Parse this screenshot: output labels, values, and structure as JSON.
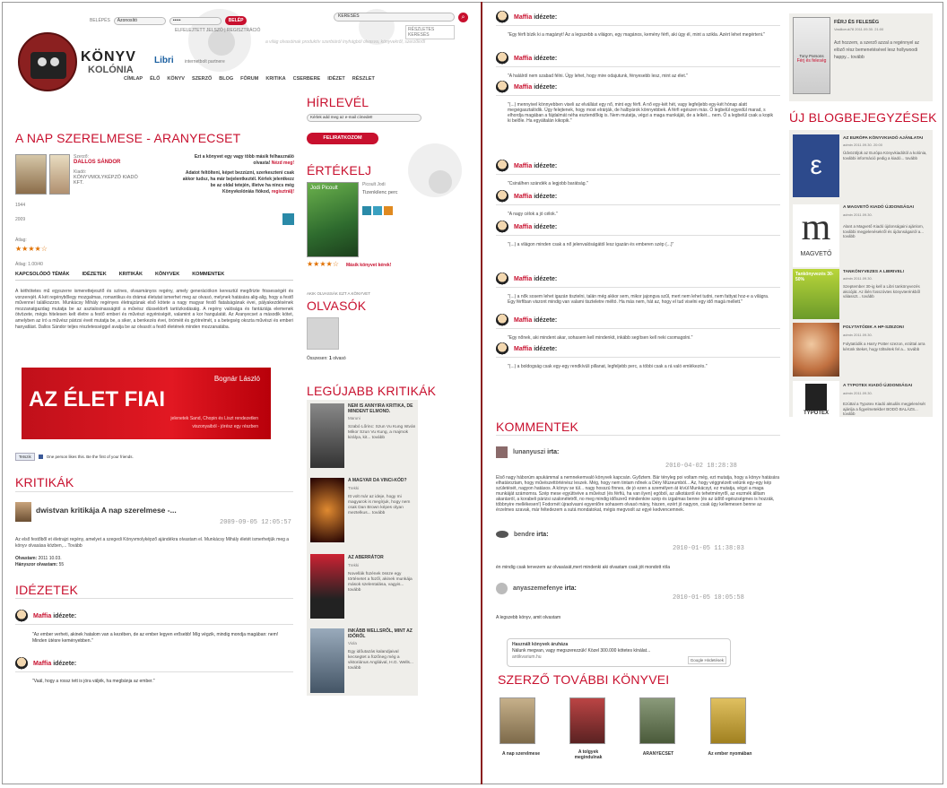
{
  "search": {
    "label": "KERESÉS",
    "advanced": "RÉSZLETES KERESÉS"
  },
  "login": {
    "label": "BELÉPÉS",
    "user": "Azonosító",
    "go": "BELÉP",
    "links": "ELFELEJTETT JELSZÓ | REGISZTRÁCIÓ"
  },
  "logo": {
    "text1": "KÖNYV",
    "text2": "KOLÓNIA",
    "partner": "Libri",
    "partner_sub": "internetbolt partnere"
  },
  "tagline": "a világ olvasóinak produktív szerbiáról ínyhágból olvasva, könyvekről, szerzőkről",
  "nav": [
    "CÍMLAP",
    "ÉLŐ",
    "KÖNYV",
    "SZERZŐ",
    "BLOG",
    "FÓRUM",
    "KRITIKA",
    "CSERBERE",
    "IDÉZET",
    "RÉSZLET"
  ],
  "book": {
    "title": "A NAP SZERELMESE - ARANYECSET",
    "author_label": "Szerző:",
    "author": "DALLOS SÁNDOR",
    "publisher_label": "Kiadó:",
    "publisher": "KÖNYVMOLYKÉPZŐ KIADÓ KFT.",
    "year1": "1944",
    "year2": "2009",
    "rating_label": "Átlag:",
    "rating_count": "Átlag: 1.00/40",
    "notice1": "Ezt a könyvet egy vagy több másik felhasználó olvasta!",
    "notice_link": "Nézd meg!",
    "notice2": "Adatot feltölteni, képet bezzúzni, szerkeszteni csak akkor tudsz, ha már bejelentkeztél. Kérlek jelentkezz be az oldal tetején, illetve ha nincs még Könyvkolóniás fiókod,",
    "notice_reg": "regisztrálj!"
  },
  "tabs": [
    "KAPCSOLÓDÓ TÉMÁK",
    "IDÉZETEK",
    "KRITIKÁK",
    "KÖNYVEK",
    "KOMMENTEK"
  ],
  "description": "A kéthötetes mű egyszerre ismerettejesztő és színes, olvasmányos regény, amely generációkon keresztül megőrizte frissességét és vonzerejét. A két regénybőlegy mozgalmas, romantikus és drámai életutat ismerhet meg az olvasó, melynek hatására alig-alig, hogy a festő művennel találkozzon. Munkácsy Mihály regényes életrajzának első kötete a nagy magyar festő fiatalságának évei, pályakezdésének mozzanatgazdag mutatja be az asztalosinasságtól a művész düsseldorfi tartózkodásáig. A regény valósága és fantáziája elemenek ötvözete, mégis hitelesen kelt életre a festő emberi és művészi egyéniségét, valamint a kor hangulatát. Az Aranyecset a második kötet, amelyben az író a művész párizsi éveit mutatja be, a siker, a benkezés évei, öröméit és gyötrelmét, s a betegség okozta művészi és emberi hanyatlást. Dallos Sándor teljes részletességgel avatja be az olvasót a festő életének minden mozzanatába.",
  "banner": {
    "author": "Bognár László",
    "title": "AZ ÉLET FIAI",
    "sub1": "jelenetek Sand, Chopin és Liszt rendezetlen",
    "sub2": "viszonyaiból - jórész egy részben"
  },
  "like": {
    "btn": "Tetszik",
    "text": "One person likes this. Be the first of your friends."
  },
  "critiques": {
    "heading": "KRITIKÁK",
    "title": "dwistvan kritikája A nap szerelmese -...",
    "date": "2009-09-05 12:05:57",
    "body": "Az első festőből et életrajzi regény, amelyet a szegedi Könyvmolyképző ajándékra olvastam el. Munkácsy Mihály életét ismerhetjük meg a könyv olvasása közben,... Tovább",
    "read_label": "Olvastam:",
    "read_val": "2011 10.03.",
    "count_label": "Hányszor olvastam:",
    "count_val": "55"
  },
  "quotes_left": {
    "heading": "IDÉZETEK",
    "items": [
      {
        "user": "Maffia",
        "suffix": "idézete:",
        "text": "\"Az ember verheti, akinek hatalom van a kezében, de az ember legyen erősebb! Míg végzik, mindig mondja magában: nem! Minden ütésre keményebben.\""
      },
      {
        "user": "Maffia",
        "suffix": "idézete:",
        "text": "\"Vaál, hogy a rossz tett is jóra váljék, ha megbánja az ember.\""
      }
    ]
  },
  "newsletter": {
    "heading": "HÍRLEVÉL",
    "placeholder": "Kérlek add meg az e-mail címedet!",
    "btn": "FELIRATKOZOM"
  },
  "rate": {
    "heading": "ÉRTÉKELJ",
    "book_author": "Picoult Jodi",
    "book_title": "Tizenkilenc perc",
    "other": "Másik könyvet kérek!",
    "cover_author": "Jodi Picoult"
  },
  "readers": {
    "pre": "AKIK OLVASSÁK EZT A KÖNYVET",
    "heading": "OLVASÓK",
    "count_label": "Összesen:",
    "count": "1",
    "count_suffix": "olvasó"
  },
  "latest_crit": {
    "heading": "LEGÚJABB KRITIKÁK",
    "items": [
      {
        "title": "NEM IS ANNYIRA KRITIKA, DE MINDENT ELMOND.",
        "user": "Maruni",
        "text": "Szabó Lőrinc: Szun Vu Kung István Mikor Szun Vu Kung, a majmok királya, kit... tovább"
      },
      {
        "title": "A MAGYAR DA VINCI-KÓD?",
        "user": "Trekki",
        "text": "Itt volt már az ideje, hogy mi magyarok is megírjuk, hogy nem csak Dan Brown képes olyan meztelkus... tovább"
      },
      {
        "title": "AZ ABERRÁTOR",
        "user": "Trekki",
        "text": "Novellák füzének össze egy történetet a füzől, akinek munkája mások szelentalása, vagyis... tovább"
      },
      {
        "title": "INKÁBB WELLSRŐL, MINT AZ IDŐRŐL",
        "user": "Viola",
        "text": "Egy időutazás kalandjaival kecsegtet a füzőneg még a viktoriánus Angliával, H.G. Wells... tovább"
      }
    ]
  },
  "quotes_right": [
    {
      "user": "Maffia",
      "suffix": "idézete:",
      "text": "\"Egy férfi bízik ki a magányt! Az a legszebb a világon, egy magános, kemény férfi, aki úgy él, mint a szikla. Azért lehet megérteni.\""
    },
    {
      "user": "Maffia",
      "suffix": "idézete:",
      "text": "\"A halálról nem szabad félni. Úgy lehet, hogy mire odajutunk, fényesebb lesz, mint az élet.\""
    },
    {
      "user": "Maffia",
      "suffix": "idézete:",
      "text": "\"(...) mennyivel könnyebben viseli az elvállást egy nő, mint egy férfi. A nő egy-két hét, vagy legfeljebb egy-két hónap alatt megvigasztalódik. Úgy felejtenek, hogy most elrárják, de halbyárok könnyebbek. A férfi egészen más. Ő legbelül egyedül marad, s elhordja magában a fájdalmát néha esztendőkig is. Nem mutatja, végzi a maga munkáját, de a lelkét... nem. Ő a legbelül csak a kopik ki belőle. Ha egyáltalán kikopik.\""
    },
    {
      "user": "Maffia",
      "suffix": "idézete:",
      "text": "\"Csinálhen szándék a legjobb barátság.\""
    },
    {
      "user": "Maffia",
      "suffix": "idézete:",
      "text": "\"A nagy célok a jó célok.\""
    },
    {
      "user": "Maffia",
      "suffix": "idézete:",
      "text": "\"(...) a világon minden csak a nő jelenvalóságától lesz igazán és emberen szép (...)\""
    },
    {
      "user": "Maffia",
      "suffix": "idézete:",
      "text": "\"(...) a nők sosem lehet igazán tisztelni, talán még akkor sem, mikor jajongva szűl, mert nem lehet tudni, nem fattyat hoz-e a világra. Egy férfiban viszont mindig van valami tiszteletre méltó. Ha más nem, hát az, hogy el tud viselni egy idő magá mellett.\""
    },
    {
      "user": "Maffia",
      "suffix": "idézete:",
      "text": "\"Egy nőnek, aki mindent akar, sohasem kell mindenkit, inkább segítsen kell neki csomagolni.\""
    },
    {
      "user": "Maffia",
      "suffix": "idézete:",
      "text": "\"(...) a boldogság csak egy-egy rendkívüli pillanat, legfeljebb perc, a többi csak a rá való emlékezés.\""
    }
  ],
  "comments": {
    "heading": "KOMMENTEK",
    "items": [
      {
        "user": "lunanyuszi",
        "suffix": "irta:",
        "date": "2010-04-02 18:28:38",
        "text": "Első nagy háborúm apukámmal a nemnekemvaló könyvek kapcsán. Győztem. Bár tényleg poi voltam még, ezt mutatja, hogy a könyv hatására elhatároztam, hogy művészettörténész leszek. Még, hogy nem tintam nőnek a Déry Múzeumból... Az, hogy véggnézett velünk egy-egy kép születését, nagyon hatásos. A könyv se túl... nagy hosszú finnes, de jó ezen a személyen át kívül Munkácsyt, ez mutatja, végzi a maga munkáját számomra. Szép mese együttvéve a művészi (és férfiú, ha van ilyen) egóból, az alkotásról és tehetményről, az eszmék álltam akarásról, a korabeli párizsi szalonéletről, no meg mindig időszerű mindenkire szép és izgalmas benne (és az üdítő egészségmes is hozzák, többnyire mellékesen!) Fodornét újraolvasni egyenlőre sohasem olvasó mány, hiszen, ezért jó nagyon, csak úgy kellemesen benne az érzelmes szavak, már feltedezem a sutá mondatokat, mégis megvoolt az egyé kedvencemnek."
      },
      {
        "user": "bendre",
        "suffix": "irta:",
        "date": "2010-01-05 11:38:03",
        "text": "én mindig csak tervezem az olvasását,mert mindenki aki olvastam csak jót mondott róla"
      },
      {
        "user": "anyaszemefenye",
        "suffix": "irta:",
        "date": "2010-01-05 10:05:58",
        "text": "A legszebb könyv, amit olvastam"
      }
    ]
  },
  "ad": {
    "title": "Használt könyvek áruháza",
    "text": "Nálunk megvan, vagy megszerezzük! Közel 300.000 kötetes kínálat...",
    "url": "antikvarium.hu",
    "google": "Google Hirdetések"
  },
  "other_books": {
    "heading": "SZERZŐ TOVÁBBI KÖNYVEI",
    "items": [
      "A nap szerelmese",
      "A tolgyek megindulnak",
      "ARANYECSET",
      "Az ember nyomában"
    ]
  },
  "featured": {
    "title": "FÉRJ ÉS FELESÉG",
    "meta": "Vasiliceuk78 2011.09.30. 21:00",
    "text": "Azt hozzem, a szerző azzal a regénnyel az elöző rész bemenetésével lesz hollywoodi happy... tovább",
    "cover_author": "Tony Parsons",
    "cover_title": "Férj és feleség"
  },
  "blog": {
    "heading": "ÚJ BLOGBEJEGYZÉSEK",
    "items": [
      {
        "title": "AZ EURÓPA KÖNYVKIADÓ AJÁNLATAI",
        "meta": "admin 2011.09.30. 20:00",
        "text": "Üdvözöljük az Európa Könyvkiadótól a kolónia, további információ pedig a kiadó... tovább"
      },
      {
        "title": "A MAGVETŐ KIADÓ ÚJDONSÁGAI",
        "meta": "admin 2011.09.30.",
        "text": "Alant a Magvető Kiadó újdonságaini ajánlom, további megjelenésekről és újdonságairól a... tovább"
      },
      {
        "title": "TANKÖNYVEZES A LIBRIVEL!",
        "meta": "admin 2011.09.30.",
        "text": "Szeptember 30-ig kell a Libri tankönyvezés akcióját. Az ilién fosszóvtes könyvterénkből válasszt... tovább"
      },
      {
        "title": "FOLYTATÓDIK A HP-SZEZON!",
        "meta": "admin 2011.09.30.",
        "text": "Folytatódik a Harry Potter szezon, ezúttal arra kérünk titeket, hogy töltsétek fel a... tovább"
      },
      {
        "title": "A TYPOTEX KIADÓ ÚJDONSÁGAI",
        "meta": "admin 2011.09.30.",
        "text": "Ezúttal a Typotex Kiadó aktuális megjelenését ajánlja a figyelmetekbe! BODÓ BALÁZS... tovább"
      }
    ],
    "logo_m": "m",
    "magveto": "MAGVETŐ",
    "tank_badge": "Tankönyvezés 30-50%",
    "typotex": "TYPOTEX"
  }
}
